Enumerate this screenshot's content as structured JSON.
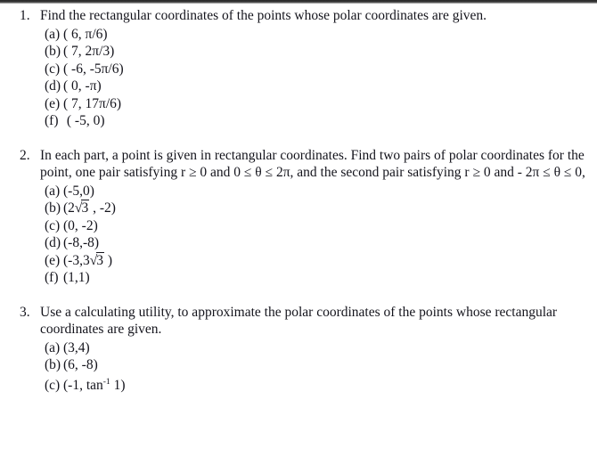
{
  "document": {
    "type": "math-worksheet",
    "topic": "Polar and rectangular coordinates",
    "text_color": "#14141c",
    "background_color": "#ffffff",
    "top_bar_color": "#2b2b2b"
  },
  "problems": [
    {
      "number": "1.",
      "intro": "Find the rectangular coordinates of the points whose polar coordinates are given.",
      "parts": [
        {
          "label": "(a)",
          "text": "( 6, π/6)"
        },
        {
          "label": "(b)",
          "text": "( 7, 2π/3)"
        },
        {
          "label": "(c)",
          "text": "( -6, -5π/6)"
        },
        {
          "label": "(d)",
          "text": "( 0, -π)"
        },
        {
          "label": "(e)",
          "text": "( 7, 17π/6)"
        },
        {
          "label": "(f)",
          "text": " ( -5, 0)"
        }
      ]
    },
    {
      "number": "2.",
      "intro": "In each part, a point is given in rectangular coordinates. Find two pairs of polar coordinates for the point, one pair satisfying r ≥  0 and  0 ≤ θ ≤ 2π, and the second pair satisfying r ≥  0 and  - 2π ≤  θ  ≤  0,",
      "parts": [
        {
          "label": "(a)",
          "text": "(-5,0)"
        },
        {
          "label": "(b)",
          "text": "(2√3 , -2)",
          "prefix": "(2",
          "sqrt_radicand": "3",
          "suffix": " , -2)"
        },
        {
          "label": "(c)",
          "text": "(0, -2)"
        },
        {
          "label": "(d)",
          "text": "(-8,-8)"
        },
        {
          "label": "(e)",
          "text": "(-3,3√3 )",
          "prefix": "(-3,3",
          "sqrt_radicand": "3",
          "suffix": " )"
        },
        {
          "label": "(f)",
          "text": "(1,1)"
        }
      ]
    },
    {
      "number": "3.",
      "intro": "Use a calculating utility, to approximate the polar coordinates of the points whose rectangular coordinates are given.",
      "parts": [
        {
          "label": "(a)",
          "text": "(3,4)"
        },
        {
          "label": "(b)",
          "text": "(6, -8)"
        },
        {
          "label": "(c)",
          "text": "(-1, tan⁻¹ 1)",
          "prefix": "(-1, tan",
          "sup": "-1",
          "suffix": " 1)"
        }
      ]
    }
  ]
}
